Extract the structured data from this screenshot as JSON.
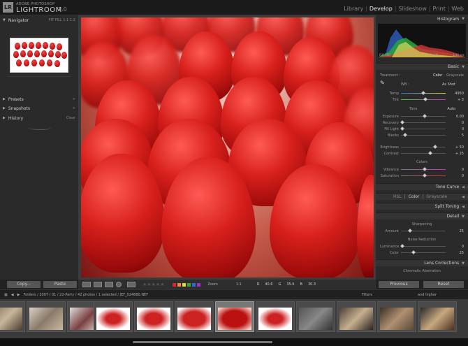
{
  "app": {
    "brand_top": "ADOBE PHOTOSHOP",
    "brand_main": "LIGHTROOM",
    "version": "1.0",
    "logo": "LR"
  },
  "modules": [
    "Library",
    "Develop",
    "Slideshow",
    "Print",
    "Web"
  ],
  "active_module": "Develop",
  "left_panel": {
    "navigator": {
      "title": "Navigator",
      "zoom_options": "FIT  FILL  1:1  1:2"
    },
    "presets": "Presets",
    "snapshots": "Snapshots",
    "history": "History",
    "history_action": "Clear",
    "copy_button": "Copy...",
    "paste_button": "Paste"
  },
  "right_panel": {
    "histogram": {
      "title": "Histogram",
      "readout": [
        "ISO 100",
        "44 mm",
        "f / 2.8",
        "1/30 sec"
      ]
    },
    "basic": {
      "title": "Basic",
      "treatment_label": "Treatment :",
      "treatment_color": "Color",
      "treatment_gray": "Grayscale",
      "wb_label": "WB :",
      "wb_value": "As Shot",
      "temp_label": "Temp",
      "temp_value": "4950",
      "tint_label": "Tint",
      "tint_value": "+ 3",
      "tone_label": "Tone",
      "tone_auto": "Auto",
      "exposure_label": "Exposure",
      "exposure_value": "0.00",
      "recovery_label": "Recovery",
      "recovery_value": "0",
      "fill_label": "Fill Light",
      "fill_value": "0",
      "blacks_label": "Blacks",
      "blacks_value": "5",
      "brightness_label": "Brightness",
      "brightness_value": "+ 50",
      "contrast_label": "Contrast",
      "contrast_value": "+ 25",
      "colors_label": "Colors",
      "vibrance_label": "Vibrance",
      "vibrance_value": "0",
      "saturation_label": "Saturation",
      "saturation_value": "0"
    },
    "tone_curve": "Tone Curve",
    "hsl_tabs": [
      "HSL",
      "Color",
      "Grayscale"
    ],
    "split_toning": "Split Toning",
    "detail": {
      "title": "Detail",
      "sharpening_label": "Sharpening",
      "amount_label": "Amount",
      "amount_value": "25",
      "noise_label": "Noise Reduction",
      "luminance_label": "Luminance",
      "luminance_value": "0",
      "color_label": "Color",
      "color_value": "25"
    },
    "lens_corrections": "Lens Corrections",
    "chromatic_label": "Chromatic Aberration",
    "previous_button": "Previous",
    "reset_button": "Reset"
  },
  "toolbar": {
    "zoom_label": "Zoom",
    "zoom_value": "1:1",
    "stat_r": "R",
    "stat_r_val": "40.6",
    "stat_g": "G",
    "stat_g_val": "35.6",
    "stat_b": "B",
    "stat_b_val": "30.3",
    "flag_colors": [
      "#d23",
      "#e83",
      "#dd3",
      "#3a3",
      "#36d",
      "#93c"
    ]
  },
  "filmstrip": {
    "path": "Folders / 2007 / 01 / 22-Party / 42 photos / 1 selected / JEF_024880.NEF",
    "filters_label": "Filters",
    "rating_filter": "and higher"
  }
}
